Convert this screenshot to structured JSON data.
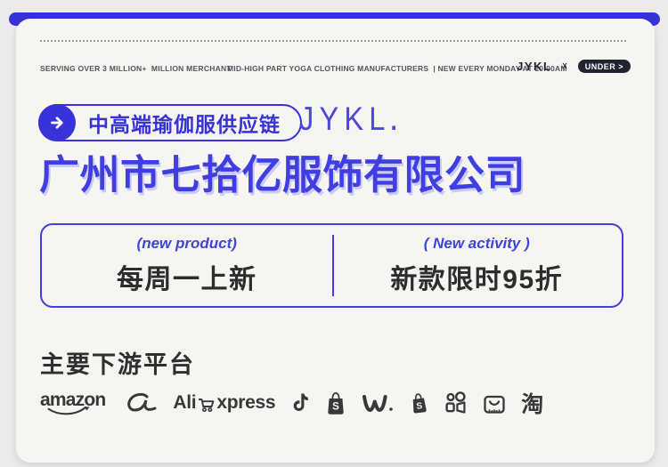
{
  "colors": {
    "accent_blue": "#3733d8",
    "title_blue": "#403ee3",
    "title_shadow_blue": "#c7cbf6",
    "page_bg": "#ebebeb",
    "card_bg": "#f7f5f1",
    "dark_text": "#2d2d2d",
    "icon_dark": "#383838",
    "header_gray": "#55545e",
    "badge_bg": "#20242e"
  },
  "header": {
    "left_text": "SERVING OVER 3 MILLION+  MILLION MERCHANT",
    "center_text": "MID-HIGH PART YOGA CLOTHING MANUFACTURERS  | NEW EVERY MONDAY AT 10:00AM",
    "brand": "JYKL",
    "separator": "X",
    "badge_label": "UNDER >"
  },
  "hero": {
    "pill_label": "中高端瑜伽服供应链",
    "logo": "JYKL",
    "logo_dot": ".",
    "company_name": "广州市七拾亿服饰有限公司"
  },
  "highlights": {
    "left": {
      "tag": "(new product)",
      "title": "每周一上新"
    },
    "right": {
      "tag": "( New activity )",
      "title": "新款限时95折"
    }
  },
  "platforms": {
    "heading": "主要下游平台",
    "amazon_label": "amazon",
    "aliexpress_prefix": "Ali",
    "aliexpress_suffix": "xpress",
    "shopee_letter": "S",
    "shopify_letter": "S",
    "taobao_char": "淘",
    "icon_names": [
      "amazon-logo",
      "alibaba-icon",
      "aliexpress-logo",
      "tiktok-icon",
      "shopee-icon",
      "wish-icon",
      "shopify-icon",
      "kwai-icon",
      "lazada-icon",
      "taobao-logo"
    ]
  }
}
